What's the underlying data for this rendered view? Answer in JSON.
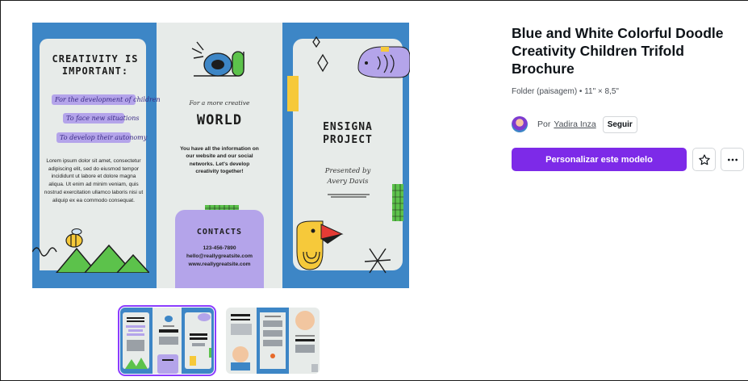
{
  "template": {
    "title": "Blue and White Colorful Doodle Creativity Children Trifold Brochure",
    "meta": "Folder (paisagem) • 11\" × 8,5\"",
    "by_label": "Por",
    "author": "Yadira Inza",
    "follow_label": "Seguir",
    "customize_label": "Personalizar este modelo",
    "favorite_icon": "star-icon",
    "more_icon": "more-icon"
  },
  "brochure": {
    "left_title": "CREATIVITY IS IMPORTANT:",
    "pills": [
      "For the development of children",
      "To face new situations",
      "To develop their autonomy"
    ],
    "left_body": "Lorem ipsum dolor sit amet, consectetur adipiscing elit, sed do eiusmod tempor incididunt ut labore et dolore magna aliqua. Ut enim ad minim veniam, quis nostrud exercitation ullamco laboris nisi ut aliquip ex ea commodo consequat.",
    "mid_sub": "For a more creative",
    "mid_title": "WORLD",
    "mid_body": "You have all the information on our website and our social networks. Let's develop creativity together!",
    "contacts_title": "CONTACTS",
    "phone": "123-456-7890",
    "email": "hello@reallygreatsite.com",
    "website": "www.reallygreatsite.com",
    "right_title": "ENSIGNA PROJECT",
    "presented_by": "Presented by",
    "presenter": "Avery Davis"
  },
  "colors": {
    "brand_purple": "#7d2ae8",
    "brochure_blue": "#3d86c6",
    "lavender": "#b4a4ea",
    "panel_bg": "#e7ebe9"
  }
}
